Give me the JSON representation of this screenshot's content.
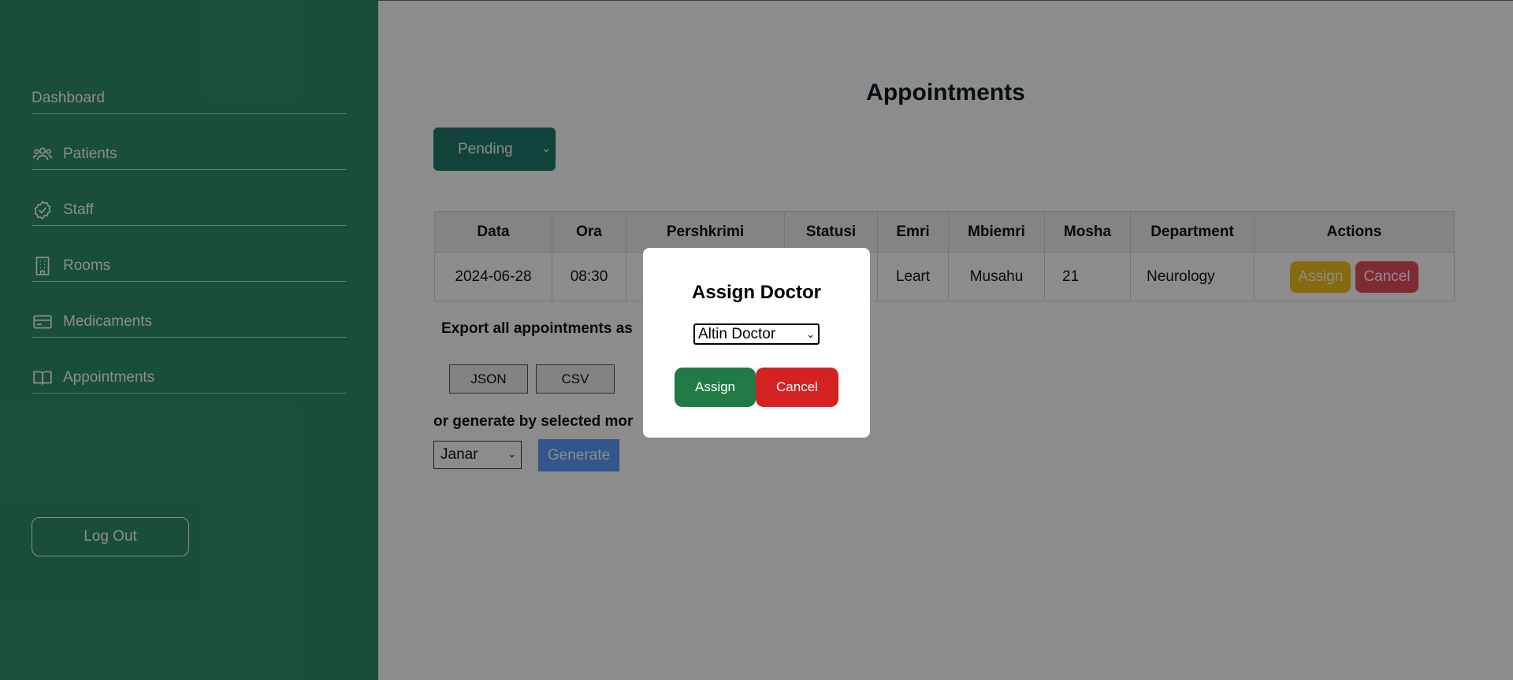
{
  "sidebar": {
    "items": [
      {
        "label": "Dashboard",
        "icon": "none"
      },
      {
        "label": "Patients",
        "icon": "users-icon"
      },
      {
        "label": "Staff",
        "icon": "badge-check-icon"
      },
      {
        "label": "Rooms",
        "icon": "building-icon"
      },
      {
        "label": "Medicaments",
        "icon": "card-icon"
      },
      {
        "label": "Appointments",
        "icon": "book-icon"
      }
    ],
    "logout_label": "Log Out"
  },
  "main": {
    "title": "Appointments",
    "status_filter": "Pending",
    "table": {
      "headers": [
        "Data",
        "Ora",
        "Pershkrimi",
        "Statusi",
        "Emri",
        "Mbiemri",
        "Mosha",
        "Department",
        "Actions"
      ],
      "rows": [
        {
          "data": "2024-06-28",
          "ora": "08:30",
          "pershkrimi": "",
          "statusi": "",
          "emri": "Leart",
          "mbiemri": "Musahu",
          "mosha": "21",
          "department": "Neurology",
          "assign_label": "Assign",
          "cancel_label": "Cancel"
        }
      ]
    },
    "export_label": "Export all appointments as",
    "export_formats": [
      "JSON",
      "CSV"
    ],
    "generate_label": "or generate by selected mor",
    "month_selected": "Janar",
    "generate_button": "Generate"
  },
  "modal": {
    "title": "Assign Doctor",
    "selected_doctor": "Altin Doctor",
    "assign_label": "Assign",
    "cancel_label": "Cancel"
  },
  "colors": {
    "sidebar": "#2f8f68",
    "primary": "#1f7a6a",
    "assign_row": "#f2c21c",
    "cancel_row": "#e94e5e",
    "generate": "#5b9bff",
    "modal_assign": "#1f7a46",
    "modal_cancel": "#d42222"
  }
}
